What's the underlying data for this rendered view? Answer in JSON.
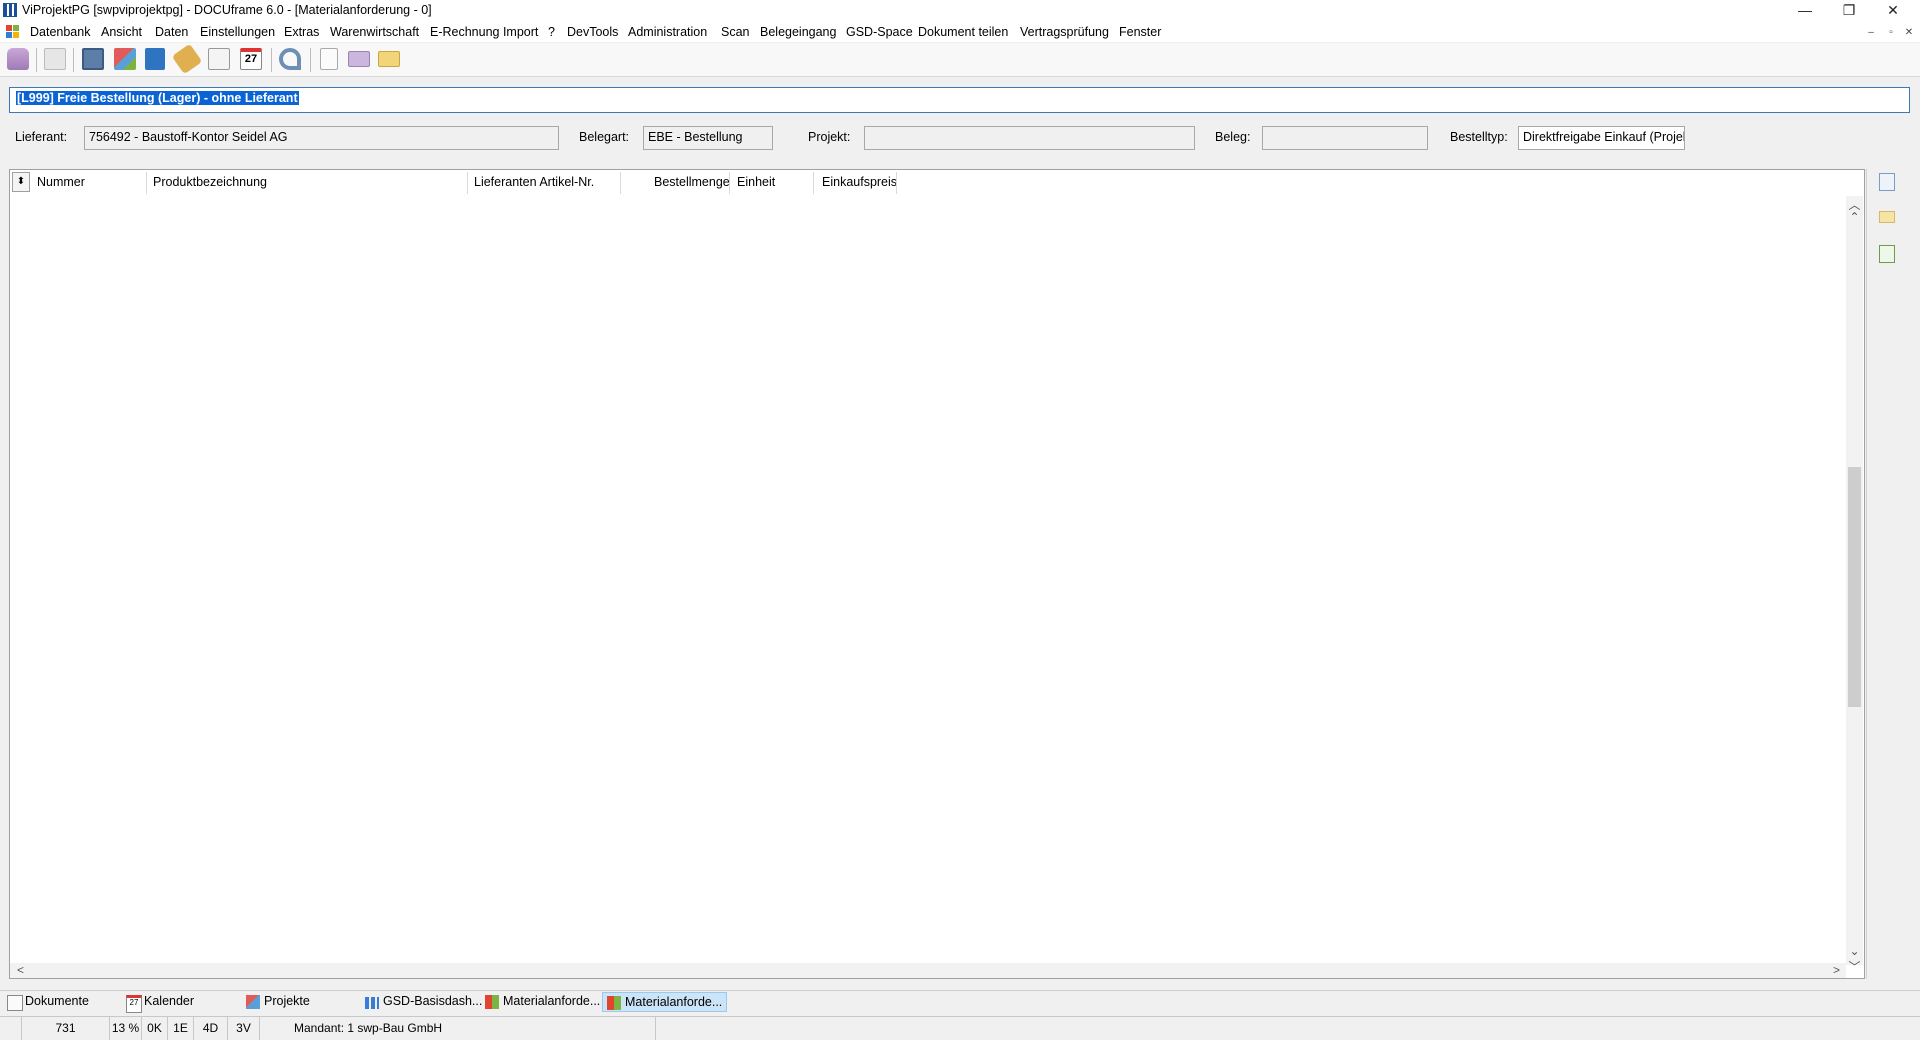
{
  "window": {
    "title": "ViProjektPG [swpviprojektpg] - DOCUframe 6.0 - [Materialanforderung - 0]",
    "minimize": "—",
    "maximize": "❐",
    "close": "✕"
  },
  "menu": {
    "items": [
      "Datenbank",
      "Ansicht",
      "Daten",
      "Einstellungen",
      "Extras",
      "Warenwirtschaft",
      "E-Rechnung Import",
      "?",
      "DevTools",
      "Administration",
      "Scan",
      "Belegeingang",
      "GSD-Space",
      "Dokument teilen",
      "Vertragsprüfung",
      "Fenster"
    ],
    "mdi_controls": [
      "–",
      "▫",
      "✕"
    ]
  },
  "toolbar": {
    "icons": [
      "database-icon",
      "print-icon",
      "contact-card-icon",
      "network-icon",
      "book-icon",
      "tag-icon",
      "documents-icon",
      "calendar-icon",
      "phone-icon",
      "new-document-icon",
      "mail-icon",
      "mail-forward-icon"
    ],
    "calendar_day": "27"
  },
  "document": {
    "header": "[L999] Freie Bestellung (Lager) - ohne Lieferant"
  },
  "form": {
    "lieferant_label": "Lieferant:",
    "lieferant_value": "756492 - Baustoff-Kontor Seidel AG",
    "belegart_label": "Belegart:",
    "belegart_value": "EBE - Bestellung",
    "projekt_label": "Projekt:",
    "projekt_value": "",
    "beleg_label": "Beleg:",
    "beleg_value": "",
    "bestelltyp_label": "Bestelltyp:",
    "bestelltyp_value": "Direktfreigabe Einkauf (Projekt"
  },
  "grid": {
    "sort_glyph": "⬍",
    "columns": [
      "Nummer",
      "Produktbezeichnung",
      "Lieferanten Artikel-Nr.",
      "Bestellmenge",
      "Einheit",
      "Einkaufspreis"
    ],
    "rows": []
  },
  "scroll": {
    "up": "︿",
    "down": "﹀",
    "top": "⌃",
    "bottom": "⌄",
    "left": "<",
    "right": ">"
  },
  "tabs": [
    {
      "label": "Dokumente",
      "active": false
    },
    {
      "label": "Kalender",
      "active": false
    },
    {
      "label": "Projekte",
      "active": false
    },
    {
      "label": "GSD-Basisdash...",
      "active": false
    },
    {
      "label": "Materialanforde...",
      "active": false
    },
    {
      "label": "Materialanforde...",
      "active": true
    }
  ],
  "calendar_tab_day": "27",
  "status": {
    "count": "731",
    "percent": "13 %",
    "k": "0K",
    "e": "1E",
    "d": "4D",
    "v": "3V",
    "mandant": "Mandant: 1 swp-Bau GmbH"
  },
  "colors": {
    "selection": "#0a64d6",
    "active_tab": "#cce4f7",
    "header_border": "#3a78b8"
  }
}
